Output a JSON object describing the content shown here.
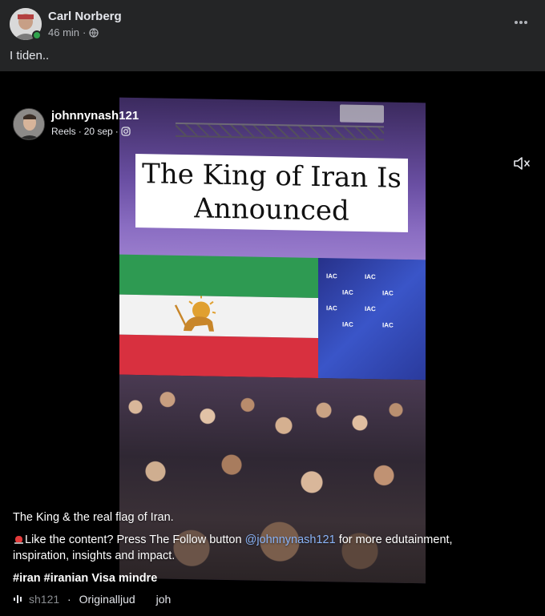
{
  "post": {
    "author": "Carl Norberg",
    "time": "46 min",
    "separator": "·",
    "text": "I tiden.."
  },
  "reel": {
    "poster_name": "johnnynash121",
    "meta_type": "Reels",
    "meta_date": "20 sep",
    "separator": "·",
    "overlay_title": "The King of Iran Is Announced",
    "iac_label": "IAC",
    "caption_line1": "The King & the real flag of Iran.",
    "caption_line2_prefix": "Like the content? Press The Follow button ",
    "caption_mention": "@johnnynash121",
    "caption_line2_suffix": " for more edutainment, inspiration, insights and impact.",
    "tags": "#iran #iranian Visa mindre",
    "audio_source": "sh121",
    "audio_sep": " · ",
    "audio_label": "Originalljud",
    "audio_trailing": "joh"
  },
  "icons": {
    "more": "more-horizontal-icon",
    "privacy": "globe-icon",
    "instagram": "instagram-icon",
    "mute": "speaker-muted-icon",
    "audio": "audio-wave-icon",
    "alert": "siren-emoji-icon"
  },
  "colors": {
    "background": "#242526",
    "video_bg": "#000000",
    "online": "#31a24c",
    "mention": "#8ab4f8"
  }
}
